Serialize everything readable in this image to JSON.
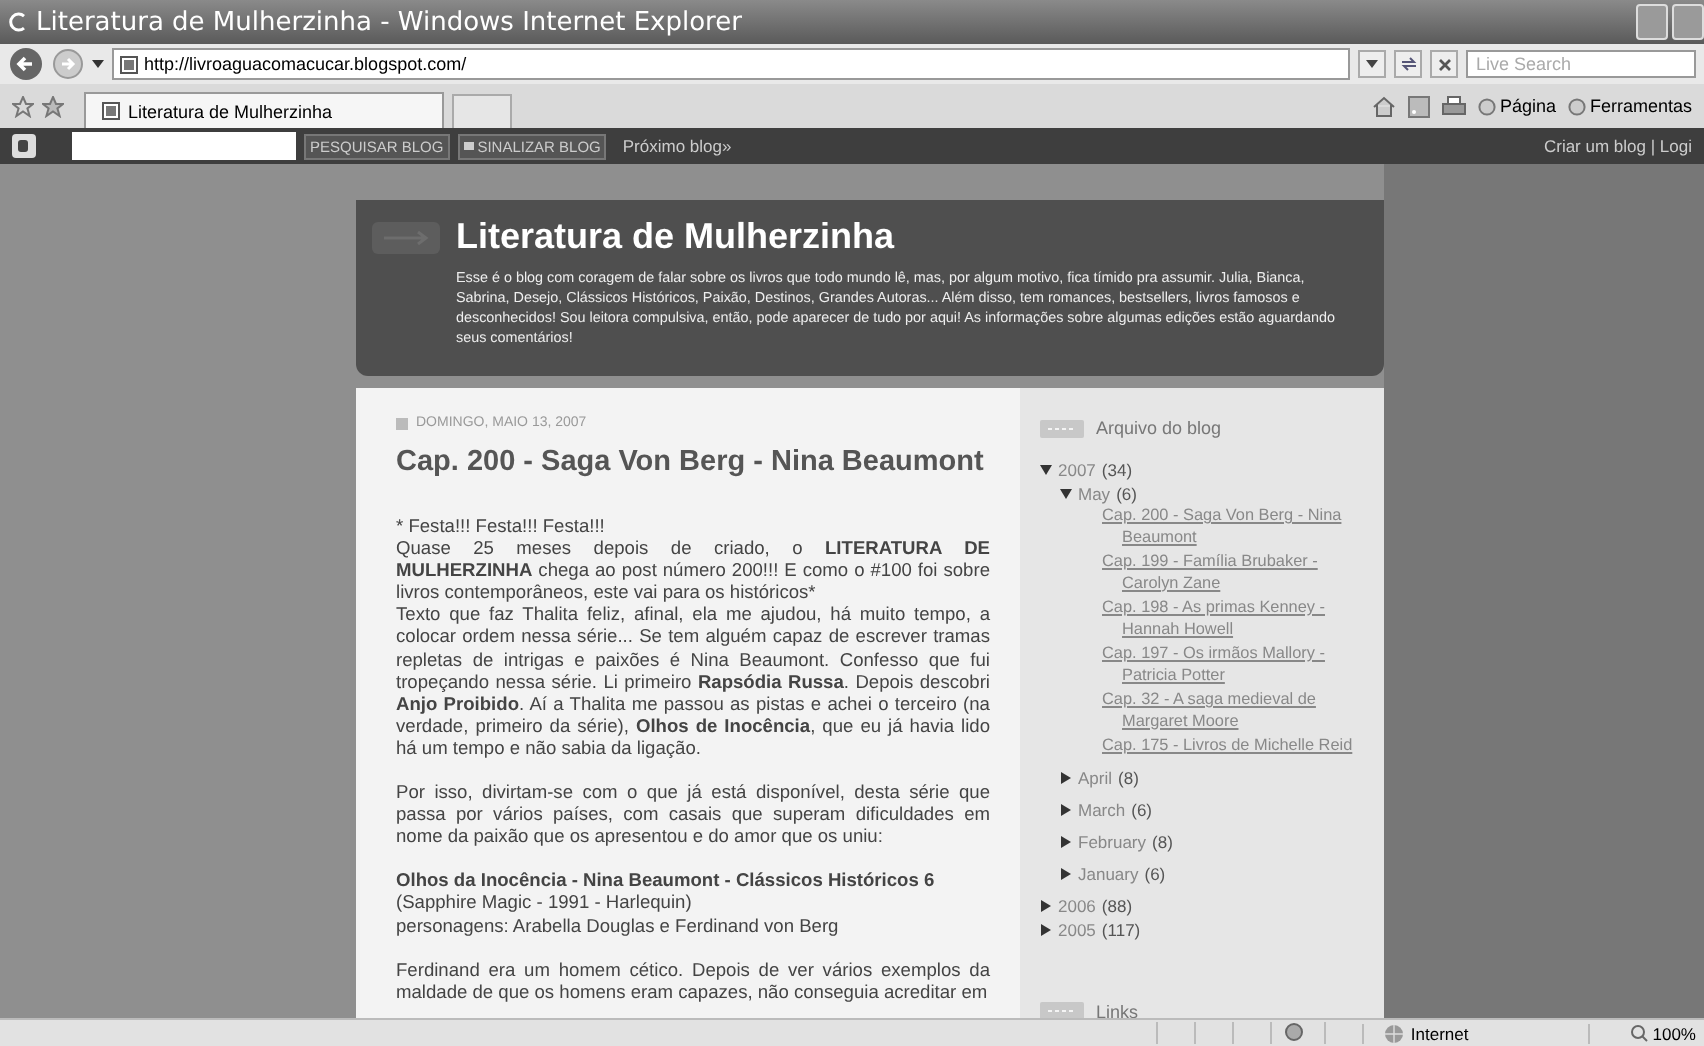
{
  "window": {
    "title": "Literatura de Mulherzinha - Windows Internet Explorer"
  },
  "address_bar": {
    "url": "http://livroaguacomacucar.blogspot.com/",
    "search_placeholder": "Live Search"
  },
  "tabs": [
    {
      "label": "Literatura de Mulherzinha",
      "selected": true
    }
  ],
  "command_bar": [
    "Página",
    "Ferramentas"
  ],
  "navbar": {
    "buttons": [
      "PESQUISAR BLOG",
      "SINALIZAR BLOG"
    ],
    "next": "Próximo blog»",
    "right": "Criar um blog | Logi"
  },
  "blog": {
    "title": "Literatura de Mulherzinha",
    "description": "Esse é o blog com coragem de falar sobre os livros que todo mundo lê, mas, por algum motivo, fica tímido pra assumir. Julia, Bianca, Sabrina, Desejo, Clássicos Históricos, Paixão, Destinos, Grandes Autoras... Além disso, tem romances, bestsellers, livros famosos e desconhecidos! Sou leitora compulsiva, então, pode aparecer de tudo por aqui! As informações sobre algumas edições estão aguardando seus comentários!"
  },
  "post": {
    "date": "DOMINGO, MAIO 13, 2007",
    "title": "Cap. 200 - Saga Von Berg - Nina Beaumont",
    "paragraphs": [
      [
        "* Festa!!! Festa!!! Festa!!!",
        "Quase 25 meses depois de criado, o **LITERATURA DE MULHERZINHA** chega ao post número 200!!! E como o #100 foi sobre livros contemporâneos, este vai para os históricos*",
        "Texto que faz Thalita feliz, afinal, ela me ajudou, há muito tempo, a colocar ordem nessa série... Se tem alguém capaz de escrever tramas repletas de intrigas e paixões é Nina Beaumont. Confesso que fui tropeçando nessa série. Li primeiro **Rapsódia Russa**. Depois descobri **Anjo Proibido**. Aí a Thalita me passou as pistas e achei o terceiro (na verdade, primeiro da série), **Olhos de Inocência**, que eu já havia lido há um tempo e não sabia da ligação."
      ],
      [
        "Por isso, divirtam-se com o que já está disponível, desta série que passa por vários países, com casais que superam dificuldades em nome da paixão que os apresentou e do amor que os uniu:"
      ],
      [
        "**Olhos da Inocência - Nina Beaumont - Clássicos Históricos 6**",
        "(Sapphire Magic - 1991 - Harlequin)",
        "personagens: Arabella Douglas e Ferdinand von Berg"
      ],
      [
        "Ferdinand era um homem cético. Depois de ver vários exemplos da maldade de que os homens eram capazes, não conseguia acreditar em"
      ]
    ]
  },
  "sidebar": {
    "archive_title": "Arquivo do blog",
    "archive": [
      {
        "label": "2007",
        "count": "(34)",
        "expanded": true,
        "children": [
          {
            "label": "May",
            "count": "(6)",
            "expanded": true,
            "children": [
              {
                "label": "Cap. 200 - Saga Von Berg - Nina Beaumont"
              },
              {
                "label": "Cap. 199 - Família Brubaker - Carolyn Zane"
              },
              {
                "label": "Cap. 198 - As primas Kenney - Hannah Howell"
              },
              {
                "label": "Cap. 197 - Os irmãos Mallory - Patricia Potter"
              },
              {
                "label": "Cap. 32 - A saga medieval de Margaret Moore"
              },
              {
                "label": "Cap. 175 - Livros de Michelle Reid"
              }
            ]
          },
          {
            "label": "April",
            "count": "(8)",
            "expanded": false
          },
          {
            "label": "March",
            "count": "(6)",
            "expanded": false
          },
          {
            "label": "February",
            "count": "(8)",
            "expanded": false
          },
          {
            "label": "January",
            "count": "(6)",
            "expanded": false
          }
        ]
      },
      {
        "label": "2006",
        "count": "(88)",
        "expanded": false
      },
      {
        "label": "2005",
        "count": "(117)",
        "expanded": false
      }
    ],
    "links_title": "Links"
  },
  "status_bar": {
    "zone": "Internet",
    "zoom": "100%"
  }
}
